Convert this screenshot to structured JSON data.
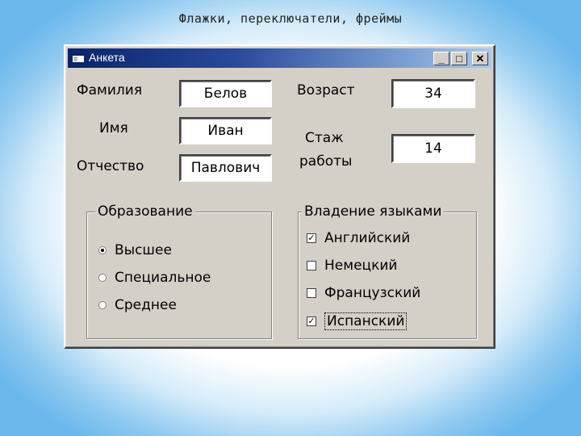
{
  "slide": {
    "title": "Флажки, переключатели, фреймы"
  },
  "window": {
    "title": "Анкета",
    "controls": {
      "minimize": "_",
      "maximize": "□",
      "close": "✕"
    }
  },
  "form": {
    "surname": {
      "label": "Фамилия",
      "value": "Белов"
    },
    "name": {
      "label": "Имя",
      "value": "Иван"
    },
    "patronymic": {
      "label": "Отчество",
      "value": "Павлович"
    },
    "age": {
      "label": "Возраст",
      "value": "34"
    },
    "experience": {
      "label_line1": "Стаж",
      "label_line2": "работы",
      "value": "14"
    }
  },
  "education": {
    "title": "Образование",
    "options": [
      {
        "label": "Высшее",
        "selected": true
      },
      {
        "label": "Специальное",
        "selected": false
      },
      {
        "label": "Среднее",
        "selected": false
      }
    ]
  },
  "languages": {
    "title": "Владение языками",
    "options": [
      {
        "label": "Английский",
        "checked": true
      },
      {
        "label": "Немецкий",
        "checked": false
      },
      {
        "label": "Французский",
        "checked": false
      },
      {
        "label": "Испанский",
        "checked": true
      }
    ]
  },
  "colors": {
    "titlebar_start": "#0a246a",
    "titlebar_end": "#a6caf0",
    "window_bg": "#d4d0c8"
  }
}
